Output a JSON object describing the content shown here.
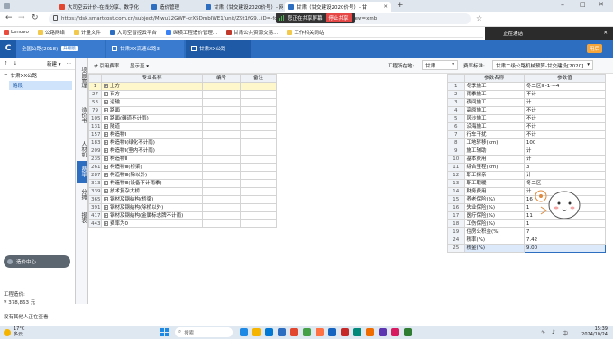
{
  "browser": {
    "tabs": [
      {
        "label": "大司空云计价-在线分享、数字化",
        "color": "#e2462f"
      },
      {
        "label": "造价管理",
        "color": "#2d6ec1"
      },
      {
        "label": "甘肃（甘交建设2020价号）- 网",
        "color": "#2d6ec1"
      },
      {
        "label": "甘肃（甘交建设2020价号）- 甘",
        "color": "#2d6ec1"
      }
    ],
    "url": "https://dsk.smartcost.com.cn/subject/Mlwu12GWF-krX5DmbIWE1/unit/Z9t1fG9...iD=-fqhVf2gTTyv2fWnbgr9Wv8rightView=xmb",
    "share_text": "您正在共享屏幕",
    "stop_share": "停止共享",
    "bookmarks": [
      "Lenovo",
      "公路网络",
      "计量文件",
      "大司空智控云平台",
      "纵横工程造价管理...",
      "甘肃公共资源交易...",
      "工作相关网站"
    ],
    "right_dock_text": "正在通话"
  },
  "app": {
    "logo_letter": "C",
    "top_tabs": [
      "全国公路(2018)",
      "甘肃XX高速公路3",
      "甘肃XX公路"
    ],
    "new_badge": "升级版",
    "user_badge": "用后"
  },
  "sidebar": {
    "new_label": "新建",
    "tree": {
      "parent": "甘肃XX公路",
      "child": "路段"
    },
    "float_widget": "造价中心...",
    "cost_label": "工程造价:",
    "cost_value": "¥ 378,863 元",
    "status_text": "没有其他人正在查看"
  },
  "vtabs": [
    "项目管理",
    "造价书",
    "人材机",
    "费率",
    "分摊",
    "报表"
  ],
  "toolbar": {
    "ref_rates": "引用费率",
    "show_to": "显示至",
    "region_label": "工程所在地:",
    "region_value": "甘肃",
    "std_label": "费率标准:",
    "std_value": "甘肃二级公路机械预算-甘交建设[2020]"
  },
  "left_table": {
    "headers": [
      "",
      "专业名称",
      "编号",
      "备注"
    ],
    "rows": [
      {
        "no": "1",
        "name": "土方"
      },
      {
        "no": "27",
        "name": "石方"
      },
      {
        "no": "53",
        "name": "运输"
      },
      {
        "no": "79",
        "name": "路面"
      },
      {
        "no": "105",
        "name": "路面(碾道不计雨)"
      },
      {
        "no": "131",
        "name": "隧道"
      },
      {
        "no": "157",
        "name": "构造物Ⅰ"
      },
      {
        "no": "183",
        "name": "构造物Ⅰ(绿化不计雨)"
      },
      {
        "no": "209",
        "name": "构造物Ⅰ(室内不计雨)"
      },
      {
        "no": "235",
        "name": "构造物Ⅱ"
      },
      {
        "no": "261",
        "name": "构造物Ⅲ(桥梁)"
      },
      {
        "no": "287",
        "name": "构造物Ⅲ(除以外)"
      },
      {
        "no": "313",
        "name": "构造物Ⅲ(设备不计雨季)"
      },
      {
        "no": "339",
        "name": "技术复杂大桥"
      },
      {
        "no": "365",
        "name": "钢材及钢结构(桥梁)"
      },
      {
        "no": "391",
        "name": "钢材及钢结构(除桥以外)"
      },
      {
        "no": "417",
        "name": "钢材及钢结构(金属标志牌不计雨)"
      },
      {
        "no": "443",
        "name": "费率为0"
      }
    ]
  },
  "right_table": {
    "headers": [
      "",
      "参数名称",
      "参数值"
    ],
    "rows": [
      {
        "no": "1",
        "name": "冬季施工",
        "value": "冬二区Ⅱ -1~-4"
      },
      {
        "no": "2",
        "name": "雨季施工",
        "value": "不计"
      },
      {
        "no": "3",
        "name": "夜间施工",
        "value": "计"
      },
      {
        "no": "4",
        "name": "高原施工",
        "value": "不计"
      },
      {
        "no": "5",
        "name": "风沙施工",
        "value": "不计"
      },
      {
        "no": "6",
        "name": "沿海施工",
        "value": "不计"
      },
      {
        "no": "7",
        "name": "行车干扰",
        "value": "不计"
      },
      {
        "no": "8",
        "name": "工地转移(km)",
        "value": "100"
      },
      {
        "no": "9",
        "name": "施工辅助",
        "value": "计"
      },
      {
        "no": "10",
        "name": "基本费用",
        "value": "计"
      },
      {
        "no": "11",
        "name": "综合里程(km)",
        "value": "3"
      },
      {
        "no": "12",
        "name": "职工探亲",
        "value": "计"
      },
      {
        "no": "13",
        "name": "职工取暖",
        "value": "冬二区"
      },
      {
        "no": "14",
        "name": "财务费用",
        "value": "计"
      },
      {
        "no": "15",
        "name": "养老保险(%)",
        "value": "16"
      },
      {
        "no": "16",
        "name": "失业保险(%)",
        "value": "1"
      },
      {
        "no": "17",
        "name": "医疗保险(%)",
        "value": "11"
      },
      {
        "no": "18",
        "name": "工伤保险(%)",
        "value": "1"
      },
      {
        "no": "19",
        "name": "住房公积金(%)",
        "value": "7"
      },
      {
        "no": "24",
        "name": "税率(%)",
        "value": "7.42"
      },
      {
        "no": "25",
        "name": "税金(%)",
        "value": "9.00"
      }
    ]
  },
  "taskbar": {
    "weather_temp": "17°C",
    "weather_desc": "多云",
    "search_placeholder": "搜索",
    "time": "15:39",
    "date": "2024/10/24",
    "icon_colors": [
      "#1e88e5",
      "#f4b400",
      "#0078d4",
      "#2d6ec1",
      "#e2462f",
      "#43a047",
      "#ff7043",
      "#1565c0",
      "#c62828",
      "#00897b",
      "#ef6c00",
      "#5e35b1",
      "#d81b60",
      "#2e7d32"
    ]
  }
}
